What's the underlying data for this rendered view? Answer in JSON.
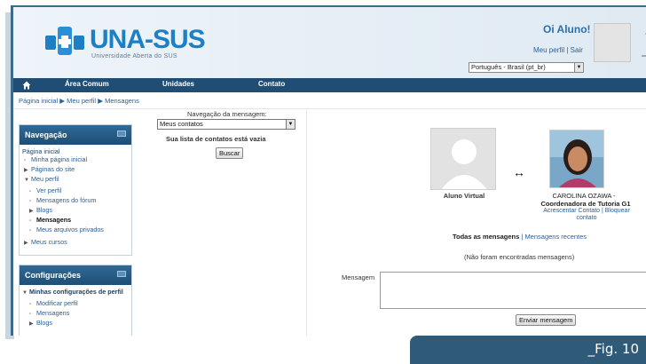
{
  "header": {
    "brand": "UNA-SUS",
    "brand_sub": "Universidade Aberta do SUS",
    "greeting": "Oi Aluno!",
    "profile_link": "Meu perfil",
    "separator": " | ",
    "logout_link": "Sair",
    "language": "Português - Brasil (pt_br)"
  },
  "navbar": {
    "items": [
      "Área Comum",
      "Unidades",
      "Contato"
    ]
  },
  "breadcrumb": {
    "items": [
      "Página inicial",
      "Meu perfil",
      "Mensagens"
    ],
    "separator": "▶"
  },
  "navigation_block": {
    "title": "Navegação",
    "home": "Página inicial",
    "items": [
      {
        "label": "Minha página inicial"
      },
      {
        "label": "Páginas do site"
      },
      {
        "label": "Meu perfil"
      },
      {
        "label": "Ver perfil"
      },
      {
        "label": "Mensagens do fórum"
      },
      {
        "label": "Blogs"
      },
      {
        "label": "Mensagens"
      },
      {
        "label": "Meus arquivos privados"
      },
      {
        "label": "Meus cursos"
      }
    ]
  },
  "settings_block": {
    "title": "Configurações",
    "items": [
      {
        "label": "Minhas configurações de perfil"
      },
      {
        "label": "Modificar perfil"
      },
      {
        "label": "Mensagens"
      },
      {
        "label": "Blogs"
      }
    ]
  },
  "message_nav": {
    "label": "Navegação da mensagem:",
    "selected": "Meus contatos",
    "empty_text": "Sua lista de contatos está vazia",
    "search_button": "Buscar"
  },
  "conversation": {
    "me_name": "Aluno Virtual",
    "other_name": "CAROLINA OZAWA -",
    "other_role": "Coordenadora de Tutoria G1",
    "add_contact": "Acrescentar Contato",
    "block_contact_1": "Bloquear",
    "block_contact_2": "contato",
    "arrow": "↔",
    "tab_all": "Todas as mensagens",
    "tab_recent": "Mensagens recentes",
    "no_messages": "(Não foram encontradas mensagens)",
    "message_label": "Mensagem",
    "send_button": "Enviar mensagem"
  },
  "figure": {
    "caption": "_Fig. 10"
  },
  "colors": {
    "navbar": "#1f4d74",
    "brand_blue": "#1e7fc4",
    "link": "#2a5e93",
    "caption_bg": "#2f5a78"
  }
}
